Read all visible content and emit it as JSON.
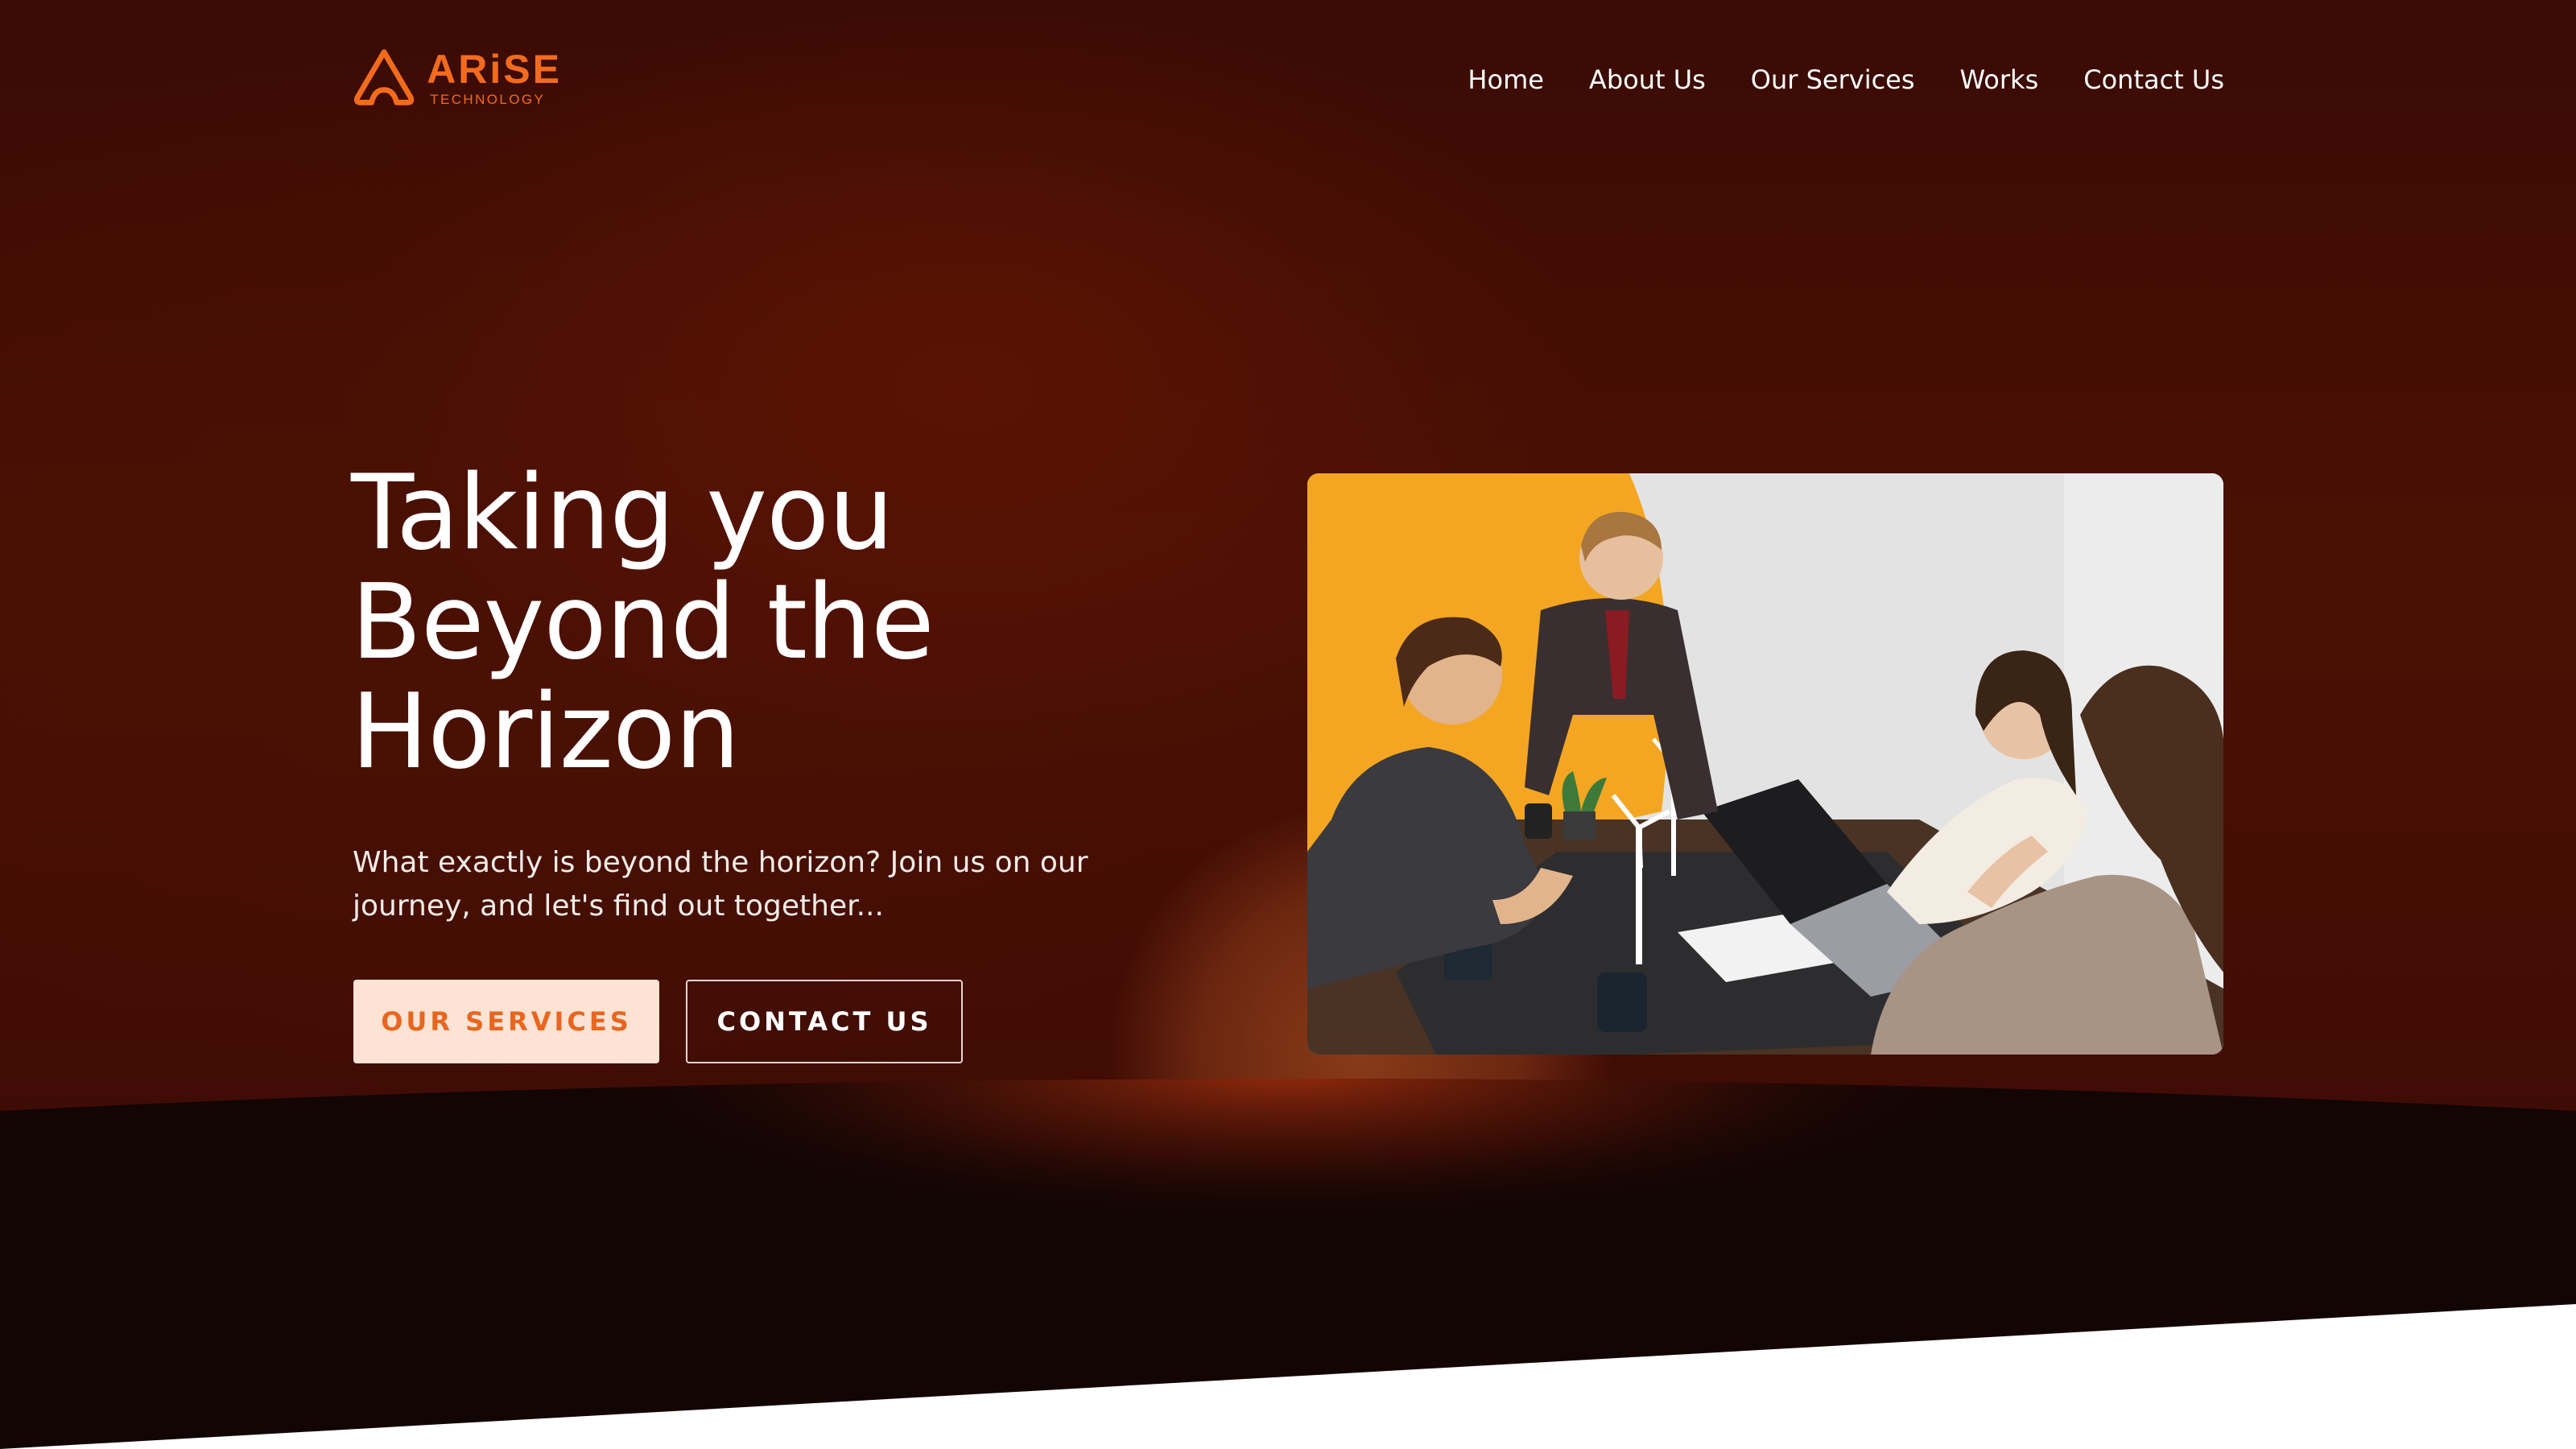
{
  "brand": {
    "name": "ARiSE",
    "tagline": "TECHNOLOGY",
    "accent_color": "#f26b1d"
  },
  "nav": {
    "items": [
      {
        "label": "Home"
      },
      {
        "label": "About Us"
      },
      {
        "label": "Our Services"
      },
      {
        "label": "Works"
      },
      {
        "label": "Contact Us"
      }
    ]
  },
  "hero": {
    "headline_lines": [
      "Taking you",
      "Beyond the",
      "Horizon"
    ],
    "subtext": "What exactly is beyond the horizon? Join us on our journey, and let's find out together...",
    "primary_button": "OUR SERVICES",
    "secondary_button": "CONTACT US",
    "image_icon": "team-meeting-photo"
  },
  "colors": {
    "hero_background": "#4b1004",
    "horizon_band": "#120504",
    "primary_button_bg": "#fde3d4",
    "primary_button_text": "#e8661f"
  }
}
